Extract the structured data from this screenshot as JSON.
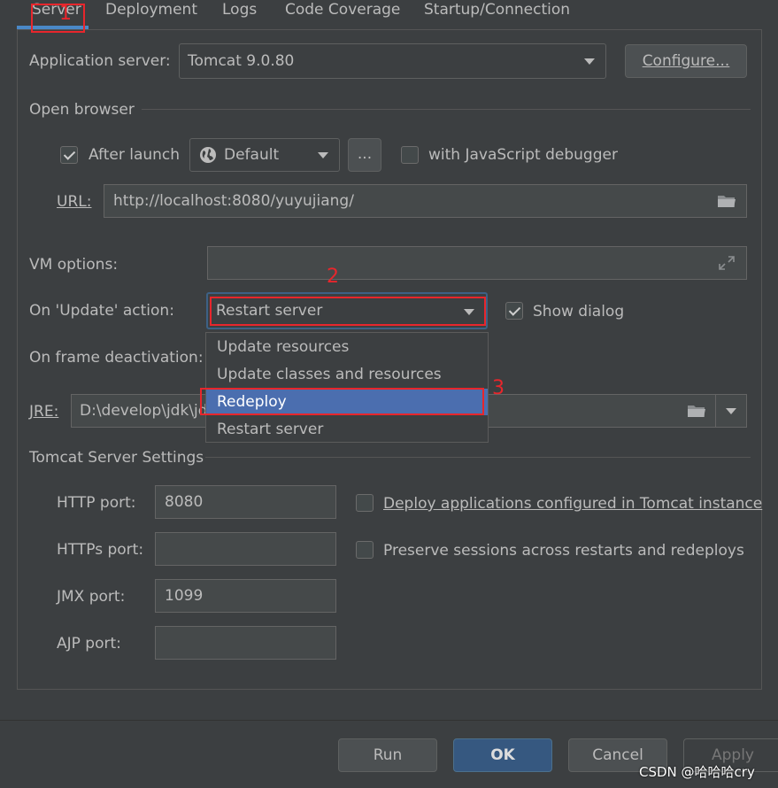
{
  "tabs": [
    {
      "label": "Server"
    },
    {
      "label": "Deployment"
    },
    {
      "label": "Logs"
    },
    {
      "label": "Code Coverage"
    },
    {
      "label": "Startup/Connection"
    }
  ],
  "app_server": {
    "label": "Application server:",
    "value": "Tomcat 9.0.80",
    "configure_label": "Configure..."
  },
  "open_browser": {
    "section_label": "Open browser",
    "after_launch_label": "After launch",
    "after_launch_checked": true,
    "browser_value": "Default",
    "more_label": "...",
    "js_debugger_label": "with JavaScript debugger",
    "js_debugger_checked": false,
    "url_label": "URL:",
    "url_value": "http://localhost:8080/yuyujiang/"
  },
  "vm_options": {
    "label": "VM options:",
    "value": ""
  },
  "update_action": {
    "label": "On 'Update' action:",
    "value": "Restart server",
    "show_dialog_label": "Show dialog",
    "show_dialog_checked": true
  },
  "update_dropdown": {
    "options": [
      {
        "label": "Update resources"
      },
      {
        "label": "Update classes and resources"
      },
      {
        "label": "Redeploy"
      },
      {
        "label": "Restart server"
      }
    ],
    "selected": "Redeploy"
  },
  "frame_deactivation": {
    "label": "On frame deactivation:"
  },
  "jre": {
    "label": "JRE:",
    "value": "D:\\develop\\jdk\\jdk"
  },
  "tomcat_settings": {
    "section_label": "Tomcat Server Settings",
    "http_port_label": "HTTP port:",
    "http_port_value": "8080",
    "https_port_label": "HTTPs port:",
    "https_port_value": "",
    "jmx_port_label": "JMX port:",
    "jmx_port_value": "1099",
    "ajp_port_label": "AJP port:",
    "ajp_port_value": "",
    "deploy_apps_label": "Deploy applications configured in Tomcat instance",
    "deploy_apps_checked": false,
    "preserve_sessions_label": "Preserve sessions across restarts and redeploys",
    "preserve_sessions_checked": false
  },
  "buttons": {
    "run": "Run",
    "ok": "OK",
    "cancel": "Cancel",
    "apply": "Apply"
  },
  "annotations": {
    "one": "1",
    "two": "2",
    "three": "3",
    "color": "#e8262c"
  },
  "watermark": "CSDN @哈哈哈cry",
  "colors": {
    "background": "#3c3f41",
    "accent": "#4a88c7",
    "selection": "#4b6eaf",
    "primary_button": "#365880"
  }
}
